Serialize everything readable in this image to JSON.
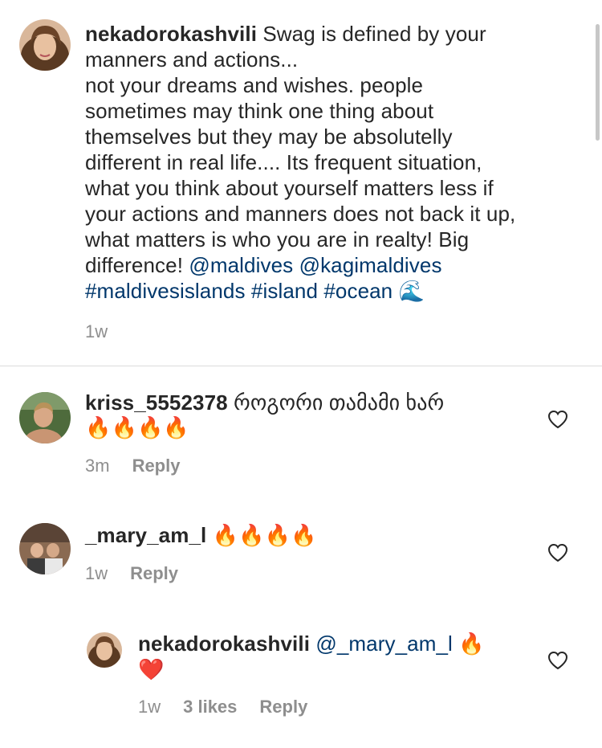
{
  "caption": {
    "username": "nekadorokashvili",
    "text_lines": [
      "Swag is defined by your",
      "manners and actions...",
      "not your dreams and wishes. people",
      "sometimes  may think one thing about",
      "themselves but they may be  absolutelly",
      "different  in real life.... Its frequent situation,",
      "what you think about yourself matters less if",
      "your actions and manners does not back it up,",
      "what matters is who you are in realty! Big",
      "difference! "
    ],
    "mentions": [
      "@maldives",
      "@kagimaldives"
    ],
    "hashtags": [
      "#maldivesislands",
      "#island",
      "#ocean"
    ],
    "wave_emoji": "🌊",
    "time": "1w"
  },
  "comments": [
    {
      "username": "kriss_5552378",
      "text": "როგორი თამამი ხარ",
      "emojis": "🔥🔥🔥🔥",
      "time": "3m",
      "reply_label": "Reply"
    },
    {
      "username": "_mary_am_l",
      "emojis": "🔥🔥🔥🔥",
      "time": "1w",
      "reply_label": "Reply"
    }
  ],
  "reply": {
    "username": "nekadorokashvili",
    "mention": "@_mary_am_l",
    "emoji_fire": "🔥",
    "emoji_heart": "❤️",
    "time": "1w",
    "likes": "3 likes",
    "reply_label": "Reply"
  },
  "colors": {
    "text": "#262626",
    "link": "#00376b",
    "meta": "#8e8e8e",
    "divider": "#dbdbdb"
  },
  "icons": {
    "like": "heart-outline-icon"
  }
}
